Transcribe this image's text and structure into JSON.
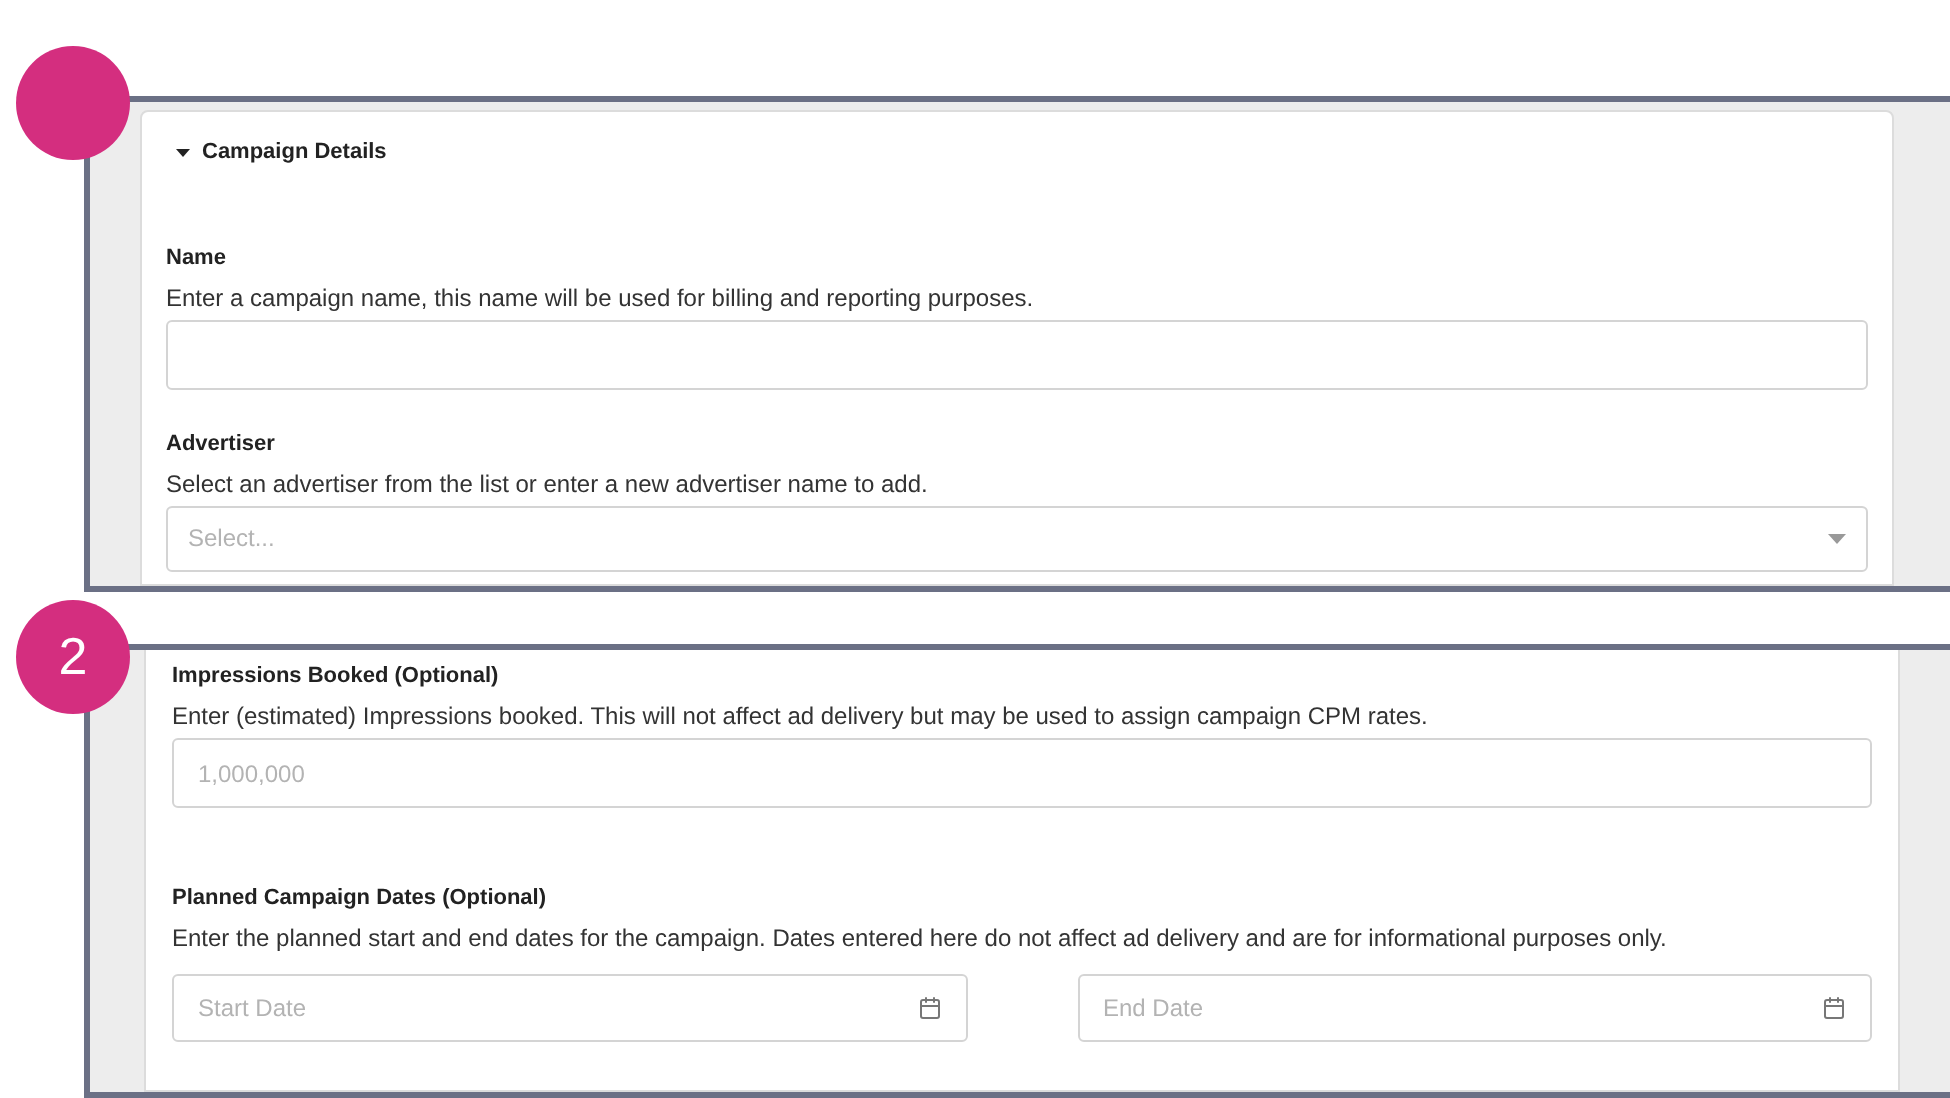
{
  "callouts": [
    {
      "section": {
        "title": "Campaign Details",
        "expanded": true
      },
      "fields": [
        {
          "kind": "text",
          "label": "Name",
          "help": "Enter a campaign name, this name will be used for billing and reporting purposes."
        },
        {
          "kind": "select",
          "label": "Advertiser",
          "help": "Select an advertiser from the list or enter a new advertiser name to add.",
          "placeholder": "Select..."
        }
      ]
    },
    {
      "label": "2",
      "fields": [
        {
          "kind": "text",
          "label": "Impressions Booked (Optional)",
          "help": "Enter (estimated) Impressions booked. This will not affect ad delivery but may be used to assign campaign CPM rates.",
          "placeholder": "1,000,000"
        },
        {
          "kind": "daterange",
          "label": "Planned Campaign Dates (Optional)",
          "help": "Enter the planned start and end dates for the campaign. Dates entered here do not affect ad delivery and are for informational purposes only.",
          "start": {
            "placeholder": "Start Date"
          },
          "end": {
            "placeholder": "End Date"
          }
        }
      ]
    }
  ]
}
